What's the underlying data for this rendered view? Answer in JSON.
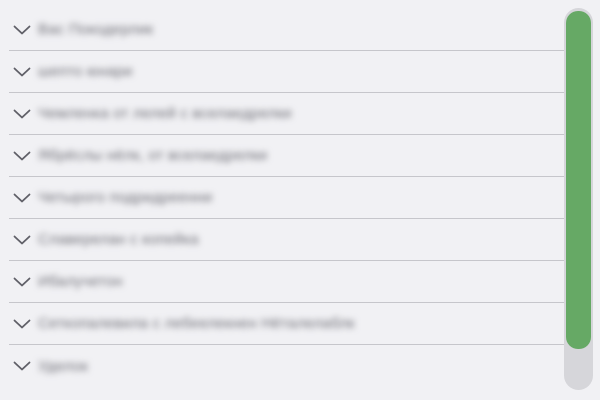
{
  "icons": {
    "row_toggle": "chevron-down-icon"
  },
  "colors": {
    "scrollbar_thumb": "#66a965",
    "scrollbar_track": "#d6d6da",
    "background": "#f1f1f4"
  },
  "accordion": {
    "items": [
      {
        "label": "Вас Покодерлик"
      },
      {
        "label": "шепто юнари"
      },
      {
        "label": "Чемленка от лелей с вселаедрелки"
      },
      {
        "label": "Ябрёслы нёлк, от вселаедрелки"
      },
      {
        "label": "Четырого подридреенни"
      },
      {
        "label": "Славерелан с копейка"
      },
      {
        "label": "Ибалучетон"
      },
      {
        "label": "Сеткопалевила с лебеелекнен Нёталелаблк"
      },
      {
        "label": "Уделок"
      }
    ]
  },
  "scrollbar": {
    "visible_fraction": 0.9,
    "scroll_position": 0
  }
}
